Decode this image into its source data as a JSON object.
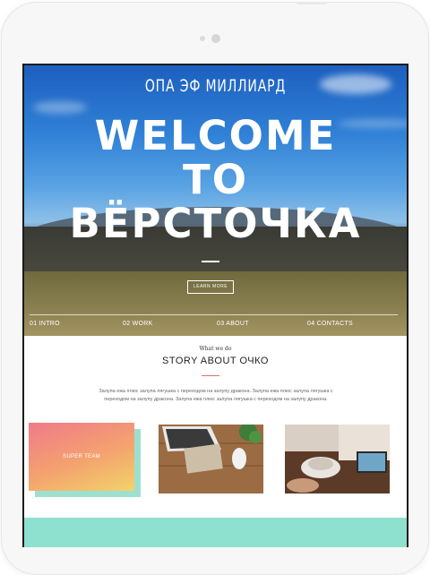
{
  "hero": {
    "brand": "ОПА ЭФ МИЛЛИАРД",
    "headline_line1": "WELCOME",
    "headline_line2": "TO",
    "headline_line3": "ВЁРСТОЧКА",
    "learn_more": "LEARN MORE"
  },
  "nav": {
    "items": [
      {
        "label": "01 INTRO"
      },
      {
        "label": "02 WORK"
      },
      {
        "label": "03 ABOUT"
      },
      {
        "label": "04 CONTACTS"
      }
    ]
  },
  "section": {
    "kicker": "What we do",
    "title": "STORY ABOUT ОЧКО",
    "description": "Залупа ежа плюс залупа лягушка с переходом на залупу дракона. Залупа ежа плюс залупа лягушка с переходом на залупу дракона. Залупа ежа плюс залупа лягушка с переходом на залупу дракона."
  },
  "cards": {
    "card1_label": "SUPER TEAM"
  },
  "colors": {
    "accent_teal": "#8ee0cf",
    "accent_red": "#e26b6b",
    "gradient_start": "#f07a8a",
    "gradient_end": "#f2d36a"
  }
}
